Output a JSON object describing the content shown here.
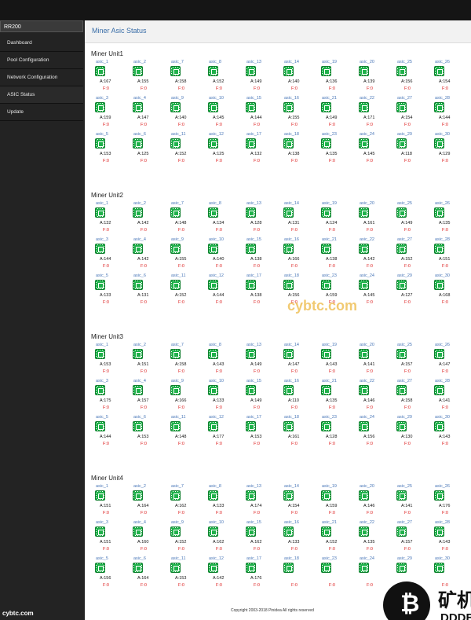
{
  "brand": "RR200",
  "nav": [
    "Dashboard",
    "Pool Configuration",
    "Network Configuration",
    "ASIC Status",
    "Update"
  ],
  "page_title": "Miner Asic Status",
  "asic_labels": [
    "asic_1",
    "asic_2",
    "asic_7",
    "asic_8",
    "asic_13",
    "asic_14",
    "asic_19",
    "asic_20",
    "asic_25",
    "asic_26",
    "asic_3",
    "asic_4",
    "asic_9",
    "asic_10",
    "asic_15",
    "asic_16",
    "asic_21",
    "asic_22",
    "asic_27",
    "asic_28",
    "asic_5",
    "asic_6",
    "asic_11",
    "asic_12",
    "asic_17",
    "asic_18",
    "asic_23",
    "asic_24",
    "asic_29",
    "asic_30"
  ],
  "units": [
    {
      "title": "Miner Unit1",
      "a": [
        "A:167",
        "A:155",
        "A:158",
        "A:152",
        "A:149",
        "A:140",
        "A:136",
        "A:139",
        "A:156",
        "A:154",
        "A:159",
        "A:147",
        "A:140",
        "A:145",
        "A:144",
        "A:155",
        "A:149",
        "A:171",
        "A:154",
        "A:144",
        "A:153",
        "A:125",
        "A:152",
        "A:125",
        "A:132",
        "A:138",
        "A:135",
        "A:145",
        "A:118",
        "A:129"
      ]
    },
    {
      "title": "Miner Unit2",
      "a": [
        "A:132",
        "A:142",
        "A:148",
        "A:134",
        "A:128",
        "A:131",
        "A:124",
        "A:161",
        "A:149",
        "A:135",
        "A:144",
        "A:142",
        "A:155",
        "A:140",
        "A:138",
        "A:166",
        "A:138",
        "A:142",
        "A:152",
        "A:151",
        "A:133",
        "A:131",
        "A:152",
        "A:144",
        "A:138",
        "A:156",
        "A:159",
        "A:145",
        "A:127",
        "A:168"
      ]
    },
    {
      "title": "Miner Unit3",
      "a": [
        "A:153",
        "A:151",
        "A:158",
        "A:143",
        "A:149",
        "A:147",
        "A:143",
        "A:141",
        "A:157",
        "A:147",
        "A:175",
        "A:157",
        "A:166",
        "A:133",
        "A:149",
        "A:110",
        "A:135",
        "A:146",
        "A:158",
        "A:141",
        "A:144",
        "A:153",
        "A:148",
        "A:177",
        "A:153",
        "A:161",
        "A:128",
        "A:156",
        "A:130",
        "A:143"
      ]
    },
    {
      "title": "Miner Unit4",
      "a": [
        "A:151",
        "A:164",
        "A:162",
        "A:133",
        "A:174",
        "A:154",
        "A:159",
        "A:146",
        "A:141",
        "A:176",
        "A:151",
        "A:160",
        "A:152",
        "A:162",
        "A:162",
        "A:133",
        "A:152",
        "A:135",
        "A:157",
        "A:143",
        "A:156",
        "A:164",
        "A:153",
        "A:142",
        "A:176",
        "",
        "",
        "",
        "",
        ""
      ]
    }
  ],
  "f_value": "F:0",
  "footer": "Copyright 2003-2018 Pinidea All rights reserved",
  "watermarks": {
    "left": "cybtc.com",
    "mid": "cybtc.com",
    "right_big": "矿机商城",
    "right_small": "DDDBTC.COM"
  }
}
